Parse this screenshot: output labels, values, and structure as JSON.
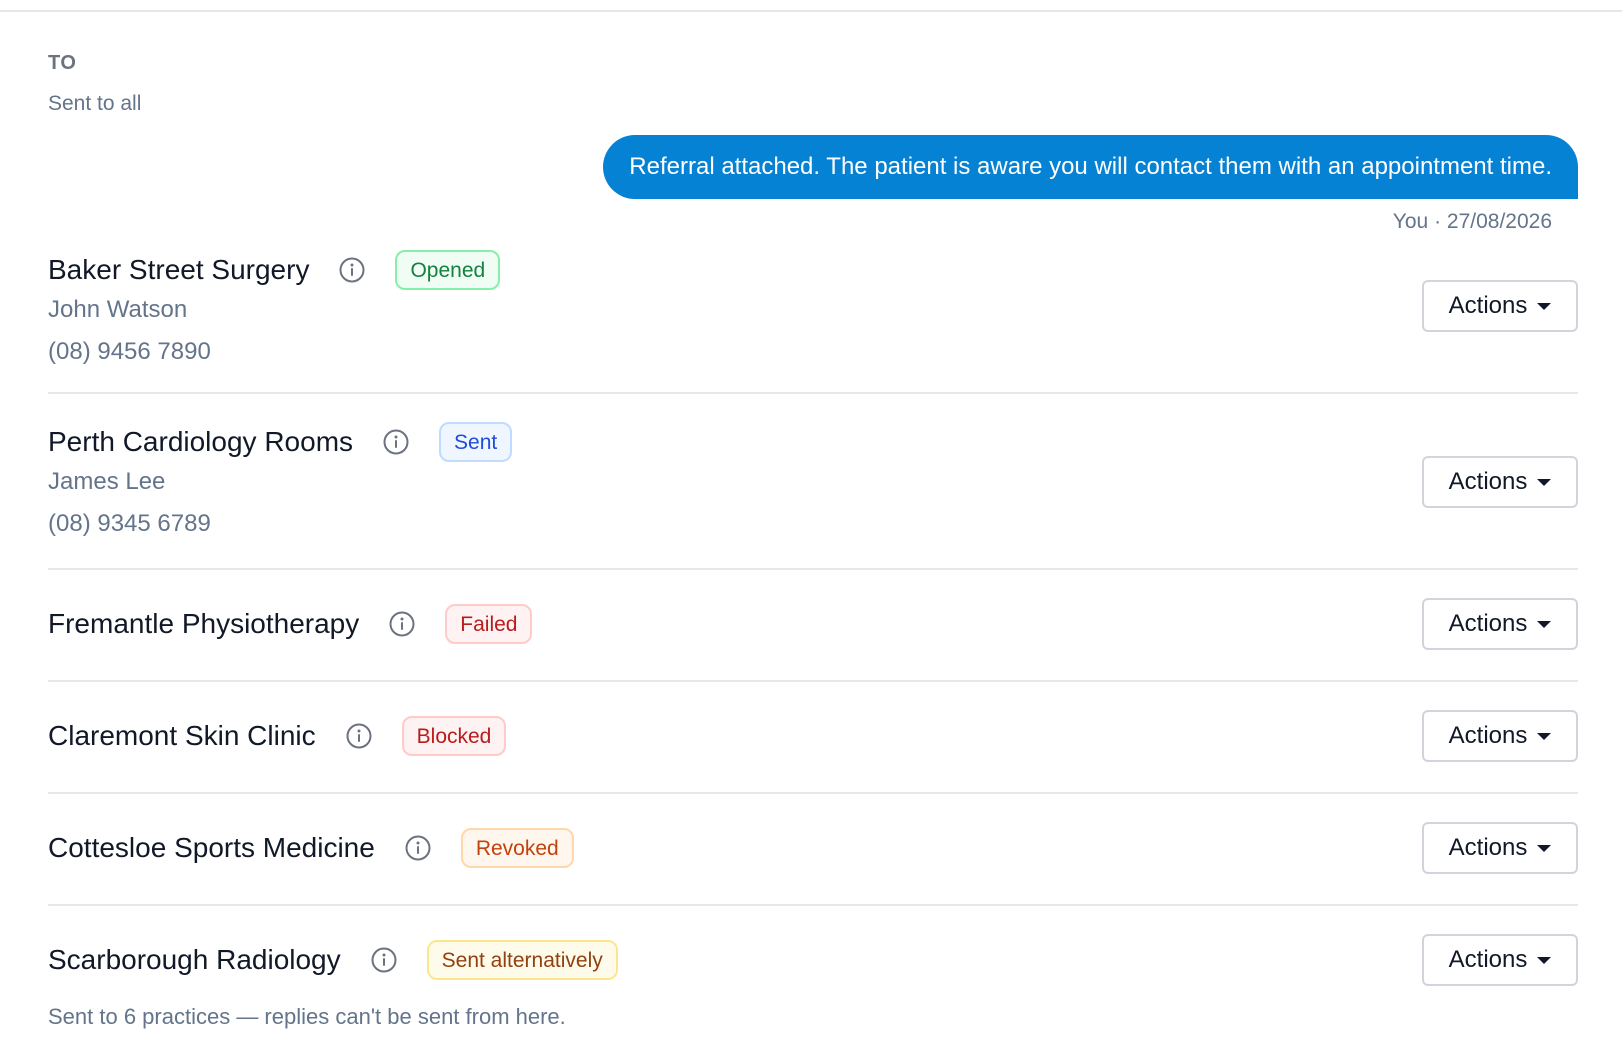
{
  "header": {
    "to_label": "TO",
    "sent_to": "Sent to all"
  },
  "message": {
    "text": "Referral attached. The patient is aware you will contact them with an appointment time.",
    "meta": "You · 27/08/2026",
    "bubble_color": "#0682d4"
  },
  "recipients": [
    {
      "name": "Baker Street Surgery",
      "status": "Opened",
      "contact": "John Watson",
      "phone": "(08) 9456 7890",
      "action": "Actions"
    },
    {
      "name": "Perth Cardiology Rooms",
      "status": "Sent",
      "contact": "James Lee",
      "phone": "(08) 9345 6789",
      "action": "Actions"
    },
    {
      "name": "Fremantle Physiotherapy",
      "status": "Failed",
      "action": "Actions"
    },
    {
      "name": "Claremont Skin Clinic",
      "status": "Blocked",
      "action": "Actions"
    },
    {
      "name": "Cottesloe Sports Medicine",
      "status": "Revoked",
      "action": "Actions"
    },
    {
      "name": "Scarborough Radiology",
      "status": "Sent alternatively",
      "action": "Actions"
    }
  ],
  "status_colors": {
    "Opened": {
      "text": "#15803d",
      "bg": "#f0fdf4",
      "border": "#86efac"
    },
    "Sent": {
      "text": "#1d4ed8",
      "bg": "#eff6ff",
      "border": "#bfdbfe"
    },
    "Failed": {
      "text": "#b91c1c",
      "bg": "#fef2f2",
      "border": "#fecaca"
    },
    "Blocked": {
      "text": "#b91c1c",
      "bg": "#fef2f2",
      "border": "#fecaca"
    },
    "Revoked": {
      "text": "#c2410c",
      "bg": "#fff7ed",
      "border": "#fed7aa"
    },
    "Sent alternatively": {
      "text": "#92400e",
      "bg": "#fffbeb",
      "border": "#fde68a"
    }
  },
  "footer": {
    "note": "Sent to 6 practices — replies can't be sent from here."
  }
}
